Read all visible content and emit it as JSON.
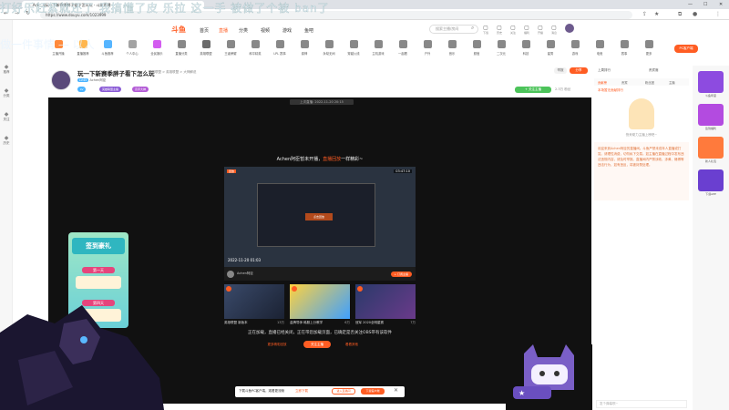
{
  "browser": {
    "tab_title": "...Ach...0玩一下新赛季胖子看下怎么玩 - 斗鱼直播",
    "url": "https://www.douyu.com/1023999"
  },
  "overlay": {
    "danmaku": "打好乐赶紧就还了 我搞懂了皮 乐拉 这一手 被做了个被 ban了",
    "left_text": "做一件事情 — 以人"
  },
  "left_sidebar": [
    {
      "icon": "home-icon",
      "label": "推荐"
    },
    {
      "icon": "category-icon",
      "label": "分类"
    },
    {
      "icon": "follow-icon",
      "label": "关注"
    },
    {
      "icon": "history-icon",
      "label": "历史"
    },
    {
      "icon": "settings-icon",
      "label": "设置"
    }
  ],
  "header": {
    "logo": "斗鱼",
    "nav": [
      "首页",
      "直播",
      "分类",
      "视频",
      "游戏",
      "鱼吧"
    ],
    "active_nav": "直播",
    "search_placeholder": "搜索主播/房间",
    "icons": [
      {
        "icon": "download-icon",
        "label": "下载"
      },
      {
        "icon": "history-icon",
        "label": "历史"
      },
      {
        "icon": "follow-icon",
        "label": "关注"
      },
      {
        "icon": "gift-icon",
        "label": "福利"
      },
      {
        "icon": "play-icon",
        "label": "开播"
      },
      {
        "icon": "message-icon",
        "label": "消息"
      }
    ]
  },
  "categories": [
    {
      "label": "主播开播",
      "color": "#ff8a3c"
    },
    {
      "label": "直播推荐",
      "color": "#ffb64d"
    },
    {
      "label": "斗鱼推荐",
      "color": "#56b5ff"
    },
    {
      "label": "个人中心",
      "color": "#a3a3a3"
    },
    {
      "label": "全民娱乐",
      "color": "#d35cf0"
    },
    {
      "label": "直播分类",
      "color": "#888888"
    },
    {
      "label": "英雄联盟",
      "color": "#6b6b6b"
    },
    {
      "label": "王者荣耀",
      "color": "#888888"
    },
    {
      "label": "和平精英",
      "color": "#888888"
    },
    {
      "label": "LPL 赛事",
      "color": "#888888"
    },
    {
      "label": "原神",
      "color": "#888888"
    },
    {
      "label": "永劫无间",
      "color": "#888888"
    },
    {
      "label": "穿越火线",
      "color": "#888888"
    },
    {
      "label": "主机游戏",
      "color": "#888888"
    },
    {
      "label": "一起看",
      "color": "#888888"
    },
    {
      "label": "户外",
      "color": "#888888"
    },
    {
      "label": "音乐",
      "color": "#888888"
    },
    {
      "label": "颜值",
      "color": "#888888"
    },
    {
      "label": "二次元",
      "color": "#888888"
    },
    {
      "label": "科技",
      "color": "#888888"
    },
    {
      "label": "星秀",
      "color": "#888888"
    },
    {
      "label": "游戏",
      "color": "#888888"
    },
    {
      "label": "电竞",
      "color": "#888888"
    },
    {
      "label": "赛事",
      "color": "#888888"
    },
    {
      "label": "更多",
      "color": "#888888"
    }
  ],
  "pc_client": "PC客户端",
  "room": {
    "title": "玩一下新赛季胖子看下怎么玩",
    "subtitle": "英雄联盟 > 英雄联盟 > 大神解说",
    "streamer": "Achen阿臣",
    "level": "LV45",
    "tags": [
      {
        "text": "LV",
        "color": "#4bb4ff"
      },
      {
        "text": "英雄联盟主播",
        "color": "#8a5bd6"
      },
      {
        "text": "高手大神",
        "color": "#b35bd6"
      }
    ],
    "follow_label": "+ 关注主播",
    "report": "举报",
    "share": "分享",
    "fans": "2.3万",
    "fans_label": "粉丝"
  },
  "player": {
    "last_live": "上次直播: 2022-11-20 20:15",
    "offline_pre": "Achen阿臣暂未开播，",
    "offline_hl": "直播回放",
    "offline_post": "一样精彩~",
    "video_badge": "回放",
    "video_duration": "03:47:10",
    "video_cta": "点击回放",
    "video_date": "2022-11-20 01:03",
    "video_author": "Achen阿臣",
    "video_subscribe": "+ 订阅主播",
    "thumbs": [
      {
        "title": "英雄联盟 新版本",
        "views": "13万"
      },
      {
        "title": "金牌导师 韩服上分教学",
        "views": "6万"
      },
      {
        "title": "冠军 2020全明星赛",
        "views": "7万"
      }
    ],
    "closed_text": "正在加载，直播已经关闭，正在带您加载页面，已确定是否关注OBS带有该软件",
    "btn_more": "更多精彩回放",
    "btn_follow": "关注主播",
    "btn_next": "看看其他",
    "download_text": "下载斗鱼PC客户端，观看更流畅",
    "download_link": "立即下载",
    "download_btn1": "进入直播间",
    "download_btn2": "下载客户端"
  },
  "signin": {
    "title": "签到豪礼",
    "day1": "第一天",
    "day2": "第四天"
  },
  "chat": {
    "tabs": [
      "贡献榜",
      "贵宾",
      "粉丝团",
      "主播"
    ],
    "top_left": "上周排行",
    "top_right": "贵宾席",
    "rank_title": "本场暂无贡献排行",
    "rank_caption": "快来助力主播上榜吧~",
    "system": "欢迎来到Achen阿臣的直播间。斗鱼严禁未成年人直播或打赏。请理性消费，切勿私下交易。如主播在直播过程中发布违法违规内容，请及时举报。直播间内严禁涉政、涉黄、赌博等违法行为，如有违反，将被封禁处理。",
    "input_placeholder": "发个弹幕呗~"
  },
  "right_sidebar": [
    {
      "label": "斗鱼年度",
      "color": "#8d4be0"
    },
    {
      "label": "签到福利",
      "color": "#b34be0"
    },
    {
      "label": "新人礼包",
      "color": "#ff7a3c"
    },
    {
      "label": "下载APP",
      "color": "#6a3fd0"
    }
  ],
  "colors": {
    "brand": "#ff5d23",
    "follow": "#4cc35a"
  }
}
